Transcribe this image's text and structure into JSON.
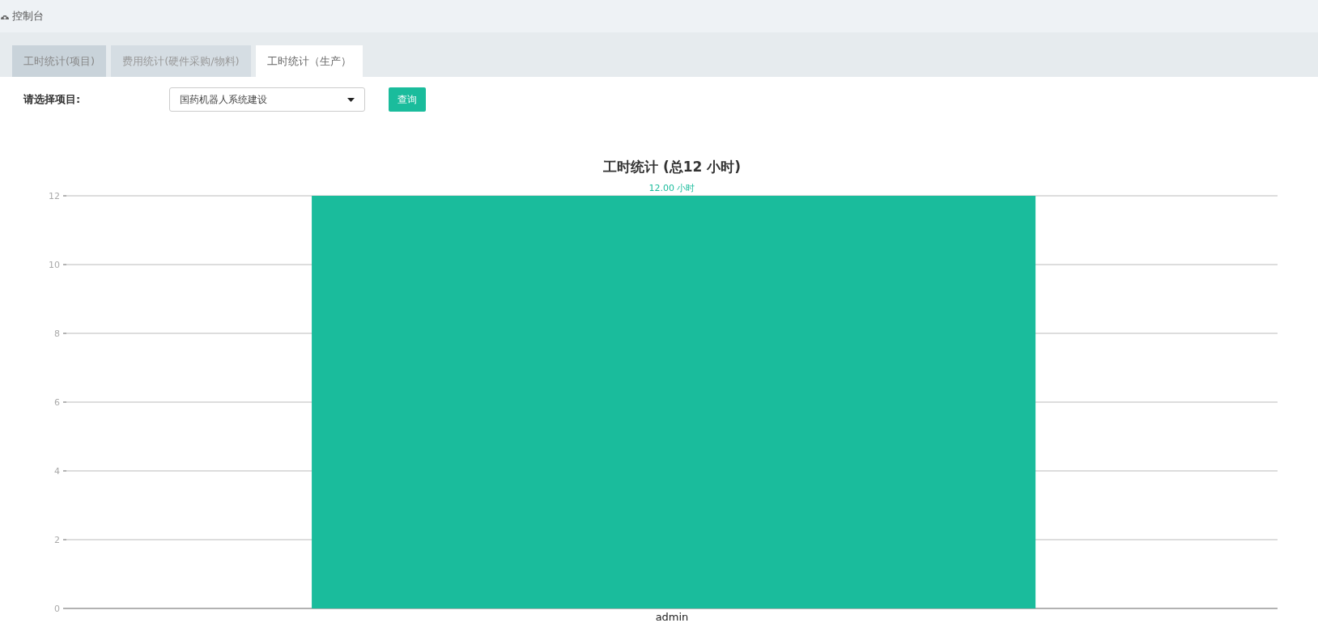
{
  "header": {
    "title": "控制台"
  },
  "tabs": [
    {
      "label": "工时统计(项目)",
      "selected": false
    },
    {
      "label": "费用统计(硬件采购/物料)",
      "selected": false
    },
    {
      "label": "工时统计（生产）",
      "selected": true
    }
  ],
  "filter": {
    "label": "请选择项目:",
    "value": "国药机器人系统建设",
    "button": "查询"
  },
  "chart_data": {
    "type": "bar",
    "title": "工时统计 (总12 小时)",
    "categories": [
      "admin"
    ],
    "series": [
      {
        "color": "#1abc9c",
        "values": [
          12
        ]
      }
    ],
    "grid": true,
    "ylim": [
      0,
      12
    ],
    "yticks": [
      0,
      2,
      4,
      6,
      8,
      10,
      12
    ],
    "value_labels": [
      "12.00 小时"
    ]
  }
}
